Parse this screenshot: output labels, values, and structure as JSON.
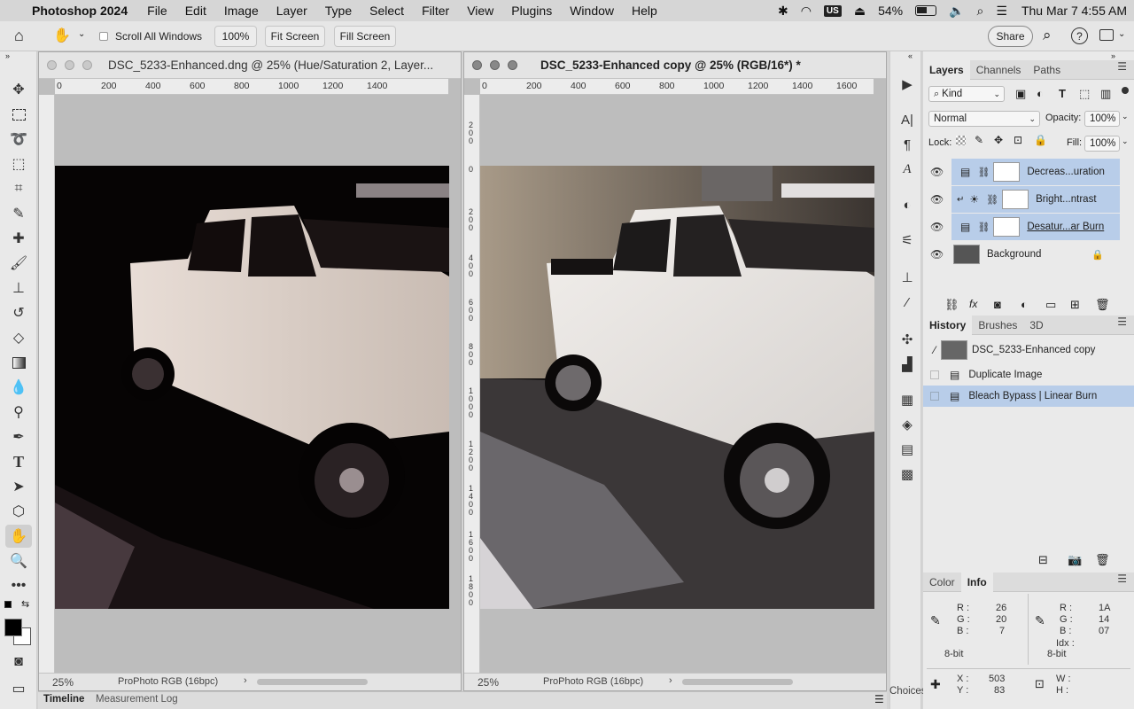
{
  "menubar": {
    "app_name": "Photoshop 2024",
    "items": [
      "File",
      "Edit",
      "Image",
      "Layer",
      "Type",
      "Select",
      "Filter",
      "View",
      "Plugins",
      "Window",
      "Help"
    ],
    "keyboard_layout": "US",
    "battery": "54%",
    "datetime": "Thu Mar 7  4:55 AM"
  },
  "options": {
    "scroll_all_windows": "Scroll All Windows",
    "zoom_100": "100%",
    "fit_screen": "Fit Screen",
    "fill_screen": "Fill Screen",
    "share": "Share"
  },
  "doc1": {
    "title": "DSC_5233-Enhanced.dng @ 25% (Hue/Saturation 2, Layer...",
    "ruler_ticks": [
      "0",
      "200",
      "400",
      "600",
      "800",
      "1000",
      "1200",
      "1400"
    ],
    "zoom": "25%",
    "profile": "ProPhoto RGB (16bpc)"
  },
  "doc2": {
    "title": "DSC_5233-Enhanced copy @ 25% (RGB/16*) *",
    "ruler_ticks": [
      "0",
      "200",
      "400",
      "600",
      "800",
      "1000",
      "1200",
      "1400",
      "1600"
    ],
    "vruler_ticks": [
      "2\n0\n0",
      "0",
      "2\n0\n0",
      "4\n0\n0",
      "6\n0\n0",
      "8\n0\n0",
      "1\n0\n0\n0",
      "1\n2\n0\n0",
      "1\n4\n0\n0",
      "1\n6\n0\n0",
      "1\n8\n0\n0"
    ],
    "zoom": "25%",
    "profile": "ProPhoto RGB (16bpc)"
  },
  "layers_panel": {
    "tabs": [
      "Layers",
      "Channels",
      "Paths"
    ],
    "filter_kind": "Kind",
    "blend_mode": "Normal",
    "opacity_label": "Opacity:",
    "opacity": "100%",
    "lock_label": "Lock:",
    "fill_label": "Fill:",
    "fill": "100%",
    "layers": [
      {
        "name": "Decreas...uration",
        "selected": true
      },
      {
        "name": "Bright...ntrast",
        "selected": true
      },
      {
        "name": "Desatur...ar Burn",
        "selected": true
      },
      {
        "name": "Background",
        "selected": false
      }
    ]
  },
  "history_panel": {
    "tabs": [
      "History",
      "Brushes",
      "3D"
    ],
    "snapshot": "DSC_5233-Enhanced copy",
    "items": [
      {
        "name": "Duplicate Image",
        "selected": false
      },
      {
        "name": "Bleach Bypass | Linear Burn",
        "selected": true
      }
    ]
  },
  "info_panel": {
    "tabs": [
      "Color",
      "Info"
    ],
    "left": {
      "R": "26",
      "G": "20",
      "B": "7",
      "bits": "8-bit"
    },
    "right": {
      "R": "1A",
      "G": "14",
      "B": "07",
      "idx": "Idx :",
      "bits": "8-bit"
    },
    "x": "503",
    "y": "83",
    "w_label": "W :",
    "h_label": "H :"
  },
  "bottom": {
    "timeline": "Timeline",
    "measurement_log": "Measurement Log",
    "choices": "Choices"
  },
  "colors": {
    "accent_selected": "#b8cde9",
    "canvas_bg": "#bdbdbd"
  }
}
